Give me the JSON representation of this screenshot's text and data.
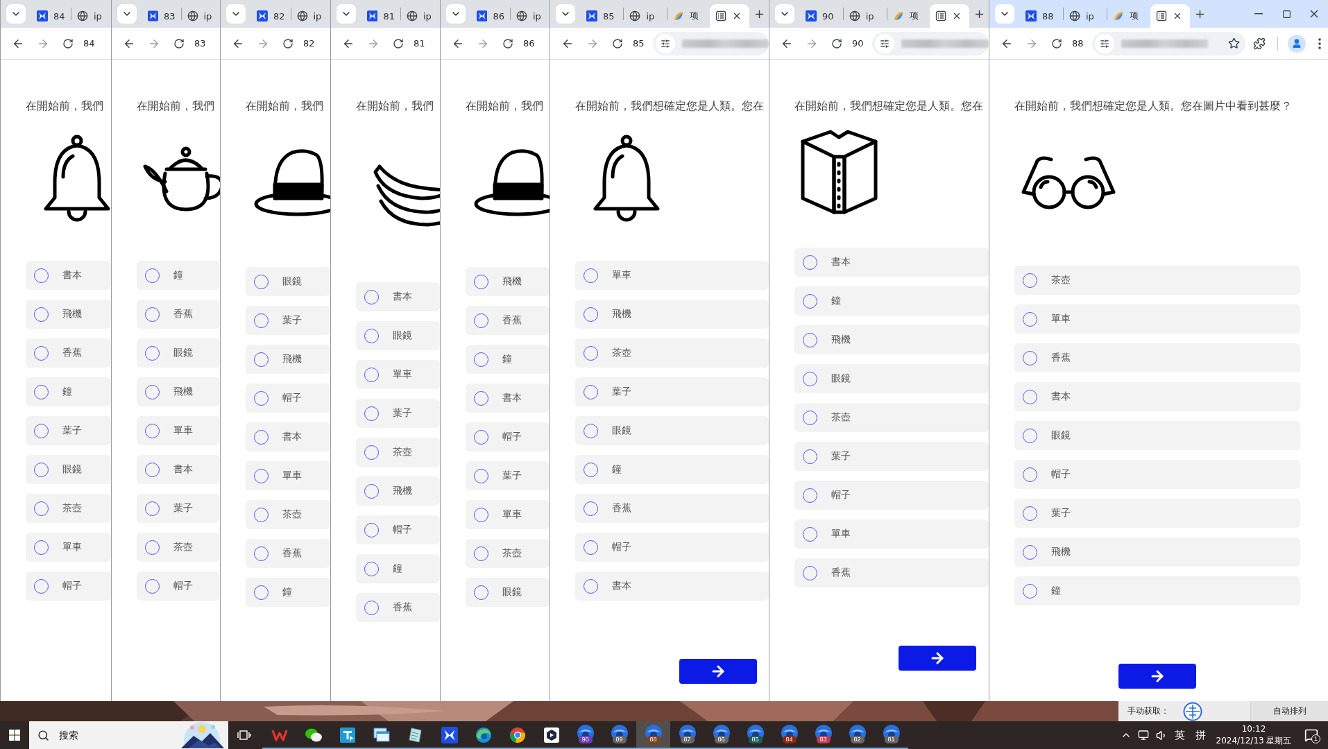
{
  "windows": [
    {
      "focused": false,
      "tabs": [
        {
          "kind": "app",
          "label": "84",
          "selected": false
        },
        {
          "kind": "site",
          "label": "ip",
          "selected": false
        }
      ],
      "page_number": "84",
      "question": "在開始前，我們",
      "image": {
        "kind": "bell"
      },
      "options": [
        {
          "label": "書本",
          "selected": false
        },
        {
          "label": "飛機",
          "selected": false
        },
        {
          "label": "香蕉",
          "selected": false
        },
        {
          "label": "鐘",
          "selected": false
        },
        {
          "label": "葉子",
          "selected": false
        },
        {
          "label": "眼鏡",
          "selected": false
        },
        {
          "label": "茶壺",
          "selected": false
        },
        {
          "label": "單車",
          "selected": false
        },
        {
          "label": "帽子",
          "selected": false
        }
      ]
    },
    {
      "focused": false,
      "tabs": [
        {
          "kind": "app",
          "label": "83",
          "selected": false
        },
        {
          "kind": "site",
          "label": "ip",
          "selected": false
        }
      ],
      "page_number": "83",
      "question": "在開始前，我們",
      "image": {
        "kind": "teapot"
      },
      "options": [
        {
          "label": "鐘",
          "selected": false
        },
        {
          "label": "香蕉",
          "selected": false
        },
        {
          "label": "眼鏡",
          "selected": false
        },
        {
          "label": "飛機",
          "selected": false
        },
        {
          "label": "單車",
          "selected": false
        },
        {
          "label": "書本",
          "selected": false
        },
        {
          "label": "葉子",
          "selected": false
        },
        {
          "label": "茶壺",
          "selected": false
        },
        {
          "label": "帽子",
          "selected": false
        }
      ]
    },
    {
      "focused": false,
      "tabs": [
        {
          "kind": "app",
          "label": "82",
          "selected": false
        },
        {
          "kind": "site",
          "label": "ip",
          "selected": false
        }
      ],
      "page_number": "82",
      "question": "在開始前，我們",
      "image": {
        "kind": "hat"
      },
      "options": [
        {
          "label": "眼鏡",
          "selected": false
        },
        {
          "label": "葉子",
          "selected": false
        },
        {
          "label": "飛機",
          "selected": false
        },
        {
          "label": "帽子",
          "selected": false
        },
        {
          "label": "書本",
          "selected": false
        },
        {
          "label": "單車",
          "selected": false
        },
        {
          "label": "茶壺",
          "selected": false
        },
        {
          "label": "香蕉",
          "selected": false
        },
        {
          "label": "鐘",
          "selected": false
        }
      ]
    },
    {
      "focused": false,
      "tabs": [
        {
          "kind": "app",
          "label": "81",
          "selected": false
        },
        {
          "kind": "site",
          "label": "ip",
          "selected": false
        }
      ],
      "page_number": "81",
      "question": "在開始前，我們",
      "image": {
        "kind": "banana"
      },
      "options": [
        {
          "label": "書本",
          "selected": false
        },
        {
          "label": "眼鏡",
          "selected": false
        },
        {
          "label": "單車",
          "selected": false
        },
        {
          "label": "葉子",
          "selected": false
        },
        {
          "label": "茶壺",
          "selected": false
        },
        {
          "label": "飛機",
          "selected": false
        },
        {
          "label": "帽子",
          "selected": false
        },
        {
          "label": "鐘",
          "selected": false
        },
        {
          "label": "香蕉",
          "selected": false
        }
      ]
    },
    {
      "focused": false,
      "tabs": [
        {
          "kind": "app",
          "label": "86",
          "selected": false
        },
        {
          "kind": "site",
          "label": "ip",
          "selected": false
        }
      ],
      "page_number": "86",
      "question": "在開始前，我們",
      "image": {
        "kind": "hat"
      },
      "options": [
        {
          "label": "飛機",
          "selected": false
        },
        {
          "label": "香蕉",
          "selected": false
        },
        {
          "label": "鐘",
          "selected": false
        },
        {
          "label": "書本",
          "selected": false
        },
        {
          "label": "帽子",
          "selected": false
        },
        {
          "label": "葉子",
          "selected": false
        },
        {
          "label": "單車",
          "selected": false
        },
        {
          "label": "茶壺",
          "selected": false
        },
        {
          "label": "眼鏡",
          "selected": false
        }
      ]
    },
    {
      "focused": false,
      "tabs": [
        {
          "kind": "app",
          "label": "85",
          "selected": false
        },
        {
          "kind": "site",
          "label": "ip",
          "selected": false
        },
        {
          "kind": "project",
          "label": "项",
          "selected": false
        },
        {
          "kind": "form",
          "selected": true
        }
      ],
      "page_number": "85",
      "question": "在開始前，我們想確定您是人類。您在",
      "image": {
        "kind": "bell"
      },
      "options": [
        {
          "label": "單車",
          "selected": false
        },
        {
          "label": "飛機",
          "selected": false
        },
        {
          "label": "茶壺",
          "selected": false
        },
        {
          "label": "葉子",
          "selected": false
        },
        {
          "label": "眼鏡",
          "selected": false
        },
        {
          "label": "鐘",
          "selected": false
        },
        {
          "label": "香蕉",
          "selected": false
        },
        {
          "label": "帽子",
          "selected": false
        },
        {
          "label": "書本",
          "selected": false
        }
      ],
      "next_button": true
    },
    {
      "focused": false,
      "tabs": [
        {
          "kind": "app",
          "label": "90",
          "selected": false
        },
        {
          "kind": "site",
          "label": "ip",
          "selected": false
        },
        {
          "kind": "project",
          "label": "项",
          "selected": false
        },
        {
          "kind": "form",
          "selected": true
        }
      ],
      "page_number": "90",
      "question": "在開始前，我們想確定您是人類。您在",
      "image": {
        "kind": "book"
      },
      "options": [
        {
          "label": "書本",
          "selected": false
        },
        {
          "label": "鐘",
          "selected": false
        },
        {
          "label": "飛機",
          "selected": false
        },
        {
          "label": "眼鏡",
          "selected": false
        },
        {
          "label": "茶壺",
          "selected": false
        },
        {
          "label": "葉子",
          "selected": false
        },
        {
          "label": "帽子",
          "selected": false
        },
        {
          "label": "單車",
          "selected": false
        },
        {
          "label": "香蕉",
          "selected": false
        }
      ],
      "next_button": true
    },
    {
      "focused": true,
      "tabs": [
        {
          "kind": "app",
          "label": "88",
          "selected": false
        },
        {
          "kind": "site",
          "label": "ip",
          "selected": false
        },
        {
          "kind": "project",
          "label": "项",
          "selected": false
        },
        {
          "kind": "form",
          "selected": true
        }
      ],
      "page_number": "88",
      "question": "在開始前，我們想確定您是人類。您在圖片中看到甚麼？",
      "image": {
        "kind": "glasses"
      },
      "options": [
        {
          "label": "茶壺",
          "selected": false
        },
        {
          "label": "單車",
          "selected": false
        },
        {
          "label": "香蕉",
          "selected": false
        },
        {
          "label": "書本",
          "selected": false
        },
        {
          "label": "眼鏡",
          "selected": false
        },
        {
          "label": "帽子",
          "selected": false
        },
        {
          "label": "葉子",
          "selected": false
        },
        {
          "label": "飛機",
          "selected": false
        },
        {
          "label": "鐘",
          "selected": false
        }
      ],
      "next_button": true
    }
  ],
  "desktop": {
    "capture_label": "手动获取：",
    "arrange_button": "自动排列"
  },
  "taskbar": {
    "search_placeholder": "搜索",
    "profiles": [
      {
        "label": "90",
        "color": "#6b3fb8",
        "selected": false
      },
      {
        "label": "89",
        "color": "#666666",
        "selected": false
      },
      {
        "label": "88",
        "color": "#7a4326",
        "selected": true
      },
      {
        "label": "87",
        "color": "#666666",
        "selected": false
      },
      {
        "label": "86",
        "color": "#666666",
        "selected": false
      },
      {
        "label": "85",
        "color": "#1e5e58",
        "selected": false
      },
      {
        "label": "84",
        "color": "#8c2a10",
        "selected": false
      },
      {
        "label": "83",
        "color": "#c23a4c",
        "selected": false
      },
      {
        "label": "82",
        "color": "#666666",
        "selected": false
      },
      {
        "label": "81",
        "color": "#666666",
        "selected": false
      }
    ],
    "tray": {
      "input_language": "英",
      "input_mode": "拼",
      "time": "10:12",
      "date": "2024/12/13 星期五",
      "notification_count": "1"
    }
  }
}
